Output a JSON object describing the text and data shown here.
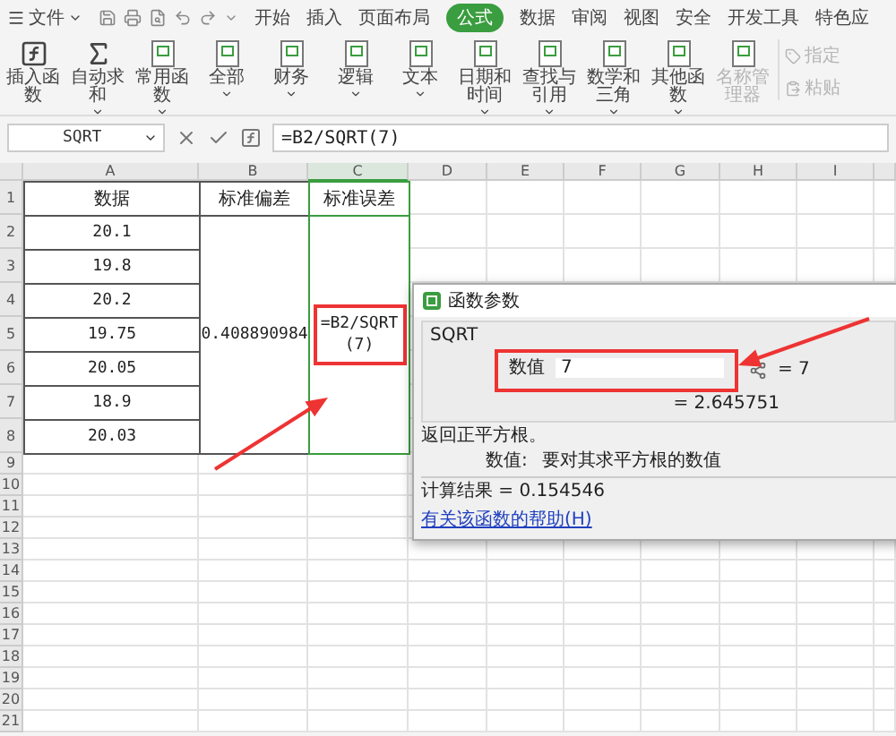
{
  "menu_bar": {
    "file_menu": "文件",
    "tabs": [
      {
        "label": "开始",
        "selected": false
      },
      {
        "label": "插入",
        "selected": false
      },
      {
        "label": "页面布局",
        "selected": false
      },
      {
        "label": "公式",
        "selected": true
      },
      {
        "label": "数据",
        "selected": false
      },
      {
        "label": "审阅",
        "selected": false
      },
      {
        "label": "视图",
        "selected": false
      },
      {
        "label": "安全",
        "selected": false
      },
      {
        "label": "开发工具",
        "selected": false
      },
      {
        "label": "特色应",
        "selected": false
      }
    ]
  },
  "ribbon": {
    "buttons": [
      {
        "kind": "fx",
        "label": "插入函数",
        "dropdown": false,
        "disabled": false
      },
      {
        "kind": "sum",
        "label": "自动求和",
        "dropdown": true,
        "disabled": false
      },
      {
        "kind": "book",
        "label": "常用函数",
        "dropdown": true,
        "disabled": false
      },
      {
        "kind": "book",
        "label": "全部",
        "dropdown": true,
        "disabled": false
      },
      {
        "kind": "book",
        "label": "财务",
        "dropdown": true,
        "disabled": false
      },
      {
        "kind": "book",
        "label": "逻辑",
        "dropdown": true,
        "disabled": false
      },
      {
        "kind": "book",
        "label": "文本",
        "dropdown": true,
        "disabled": false
      },
      {
        "kind": "book",
        "label": "日期和时间",
        "dropdown": true,
        "disabled": false
      },
      {
        "kind": "book",
        "label": "查找与引用",
        "dropdown": true,
        "disabled": false
      },
      {
        "kind": "book",
        "label": "数学和三角",
        "dropdown": true,
        "disabled": false
      },
      {
        "kind": "book",
        "label": "其他函数",
        "dropdown": true,
        "disabled": false
      },
      {
        "kind": "book",
        "label": "名称管理器",
        "dropdown": false,
        "disabled": true
      }
    ],
    "small_buttons": [
      {
        "label": "指定",
        "disabled": true
      },
      {
        "label": "粘贴",
        "disabled": true
      }
    ]
  },
  "formula_bar": {
    "name_box": "SQRT",
    "formula": "=B2/SQRT(7)"
  },
  "sheet": {
    "columns": [
      "A",
      "B",
      "C",
      "D",
      "E",
      "F",
      "G",
      "H",
      "I"
    ],
    "rows": [
      "1",
      "2",
      "3",
      "4",
      "5",
      "6",
      "7",
      "8",
      "9",
      "10",
      "11",
      "12",
      "13",
      "14",
      "15",
      "16",
      "17",
      "18",
      "19",
      "20",
      "21"
    ],
    "headers": [
      "数据",
      "标准偏差",
      "标准误差"
    ],
    "values": [
      "20.1",
      "19.8",
      "20.2",
      "19.75",
      "20.05",
      "18.9",
      "20.03"
    ],
    "std_dev": "0.408890984",
    "std_err_formula": "=B2/SQRT(7)"
  },
  "dialog": {
    "title": "函数参数",
    "function": "SQRT",
    "arg_label": "数值",
    "arg_value": "7",
    "arg_result": "= 7",
    "value_result": "= 2.645751",
    "description": "返回正平方根。",
    "arg_help_label": "数值:",
    "arg_help": "要对其求平方根的数值",
    "result": "计算结果 = 0.154546",
    "help_link": "有关该函数的帮助(H)"
  }
}
